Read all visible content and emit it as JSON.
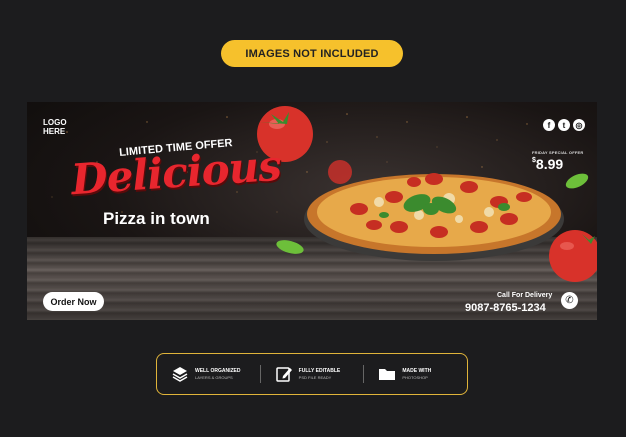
{
  "notice": {
    "label": "IMAGES NOT INCLUDED"
  },
  "banner": {
    "logo_line1": "LOGO",
    "logo_line2": "HERE",
    "limited_offer": "LIMITED TIME OFFER",
    "headline": "Delicious",
    "subheadline": "Pizza in town",
    "promo_label": "FRIDAY SPECIAL OFFER",
    "price_currency": "$",
    "price_value": "8.99",
    "order_button": "Order Now",
    "delivery_label": "Call For Delivery",
    "phone_number": "9087-8765-1234",
    "social_icons": [
      "facebook-icon",
      "twitter-icon",
      "instagram-icon"
    ],
    "social_glyphs": [
      "f",
      "t",
      "◎"
    ]
  },
  "features": [
    {
      "icon": "layers-icon",
      "title": "WELL ORGANIZED",
      "subtitle": "LAYERS & GROUPS"
    },
    {
      "icon": "edit-icon",
      "title": "FULLY EDITABLE",
      "subtitle": "PSD FILE READY"
    },
    {
      "icon": "folder-icon",
      "title": "MADE WITH",
      "subtitle": "PHOTOSHOP"
    }
  ],
  "colors": {
    "accent_yellow": "#f6c12c",
    "headline_red": "#e8262e",
    "background": "#1c1c1e"
  }
}
